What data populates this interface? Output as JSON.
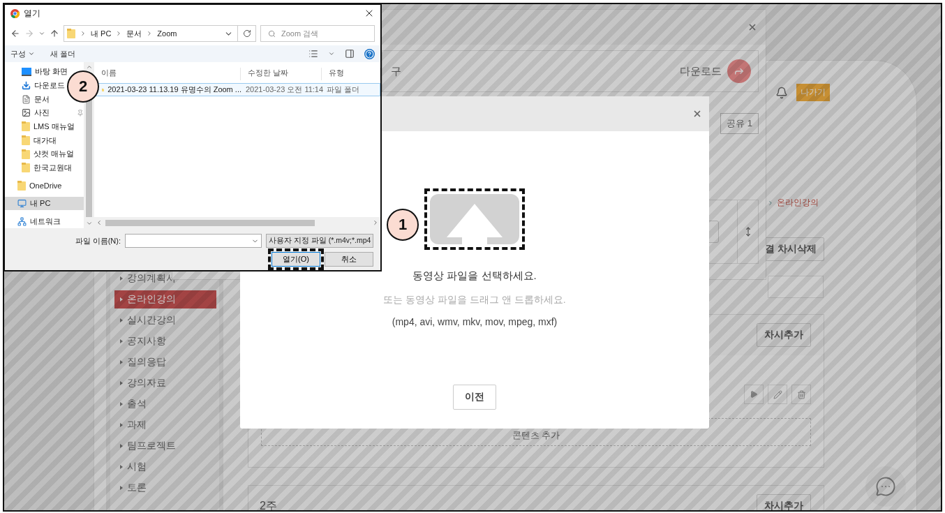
{
  "lms_page": {
    "exit_button": "나가기",
    "breadcrumb": "온라인강의",
    "bulk_delete_button": "결 차시삭제",
    "sidebar_items": [
      {
        "label": "강의계획서",
        "selected": false
      },
      {
        "label": "온라인강의",
        "selected": true
      },
      {
        "label": "실시간강의",
        "selected": false
      },
      {
        "label": "공지사항",
        "selected": false
      },
      {
        "label": "질의응답",
        "selected": false
      },
      {
        "label": "강의자료",
        "selected": false
      },
      {
        "label": "출석",
        "selected": false
      },
      {
        "label": "과제",
        "selected": false
      },
      {
        "label": "팀프로젝트",
        "selected": false
      },
      {
        "label": "시험",
        "selected": false
      },
      {
        "label": "토론",
        "selected": false
      }
    ],
    "weeks": [
      {
        "add_button": "차시추가",
        "add_content": "콘텐츠 추가"
      },
      {
        "title": "2주",
        "add_button": "차시추가"
      }
    ]
  },
  "download_dialog": {
    "title_fragment": "구",
    "download_label": "다운로드",
    "share_button": "공유 1"
  },
  "upload_modal": {
    "prompt": "동영상 파일을 선택하세요.",
    "hint": "또는 동영상 파일을 드래그 앤 드롭하세요.",
    "formats": "(mp4, avi, wmv, mkv, mov, mpeg, mxf)",
    "back_button": "이전"
  },
  "file_dialog": {
    "title": "열기",
    "path": [
      "내 PC",
      "문서",
      "Zoom"
    ],
    "search_placeholder": "Zoom 검색",
    "organize_button": "구성",
    "new_folder_button": "새 폴더",
    "quick_access_items": [
      {
        "label": "바탕 화면",
        "kind": "desktop",
        "pinned": false
      },
      {
        "label": "다운로드",
        "kind": "download"
      },
      {
        "label": "문서",
        "kind": "document"
      },
      {
        "label": "사진",
        "kind": "picture",
        "pinned": true
      },
      {
        "label": "LMS 매뉴얼",
        "kind": "folder",
        "pinned": false
      },
      {
        "label": "대가대",
        "kind": "folder",
        "pinned": false
      },
      {
        "label": "샷컷 매뉴얼",
        "kind": "folder",
        "pinned": false
      },
      {
        "label": "한국교원대",
        "kind": "folder",
        "pinned": false
      }
    ],
    "locations": [
      {
        "label": "OneDrive",
        "kind": "folder",
        "selected": false
      },
      {
        "label": "내 PC",
        "kind": "pc",
        "selected": true
      },
      {
        "label": "네트워크",
        "kind": "network",
        "selected": false
      }
    ],
    "columns": [
      "이름",
      "수정한 날짜",
      "유형"
    ],
    "rows": [
      {
        "name": "2021-03-23 11.13.19 유명수의 Zoom ...",
        "date": "2021-03-23 오전 11:14",
        "type": "파일 폴더",
        "selected": true
      }
    ],
    "file_name_label": "파일 이름(N):",
    "filter": "사용자 지정 파일 (*.m4v;*.mp4",
    "open_button": "열기(O)",
    "cancel_button": "취소"
  },
  "callouts": [
    "1",
    "2"
  ]
}
